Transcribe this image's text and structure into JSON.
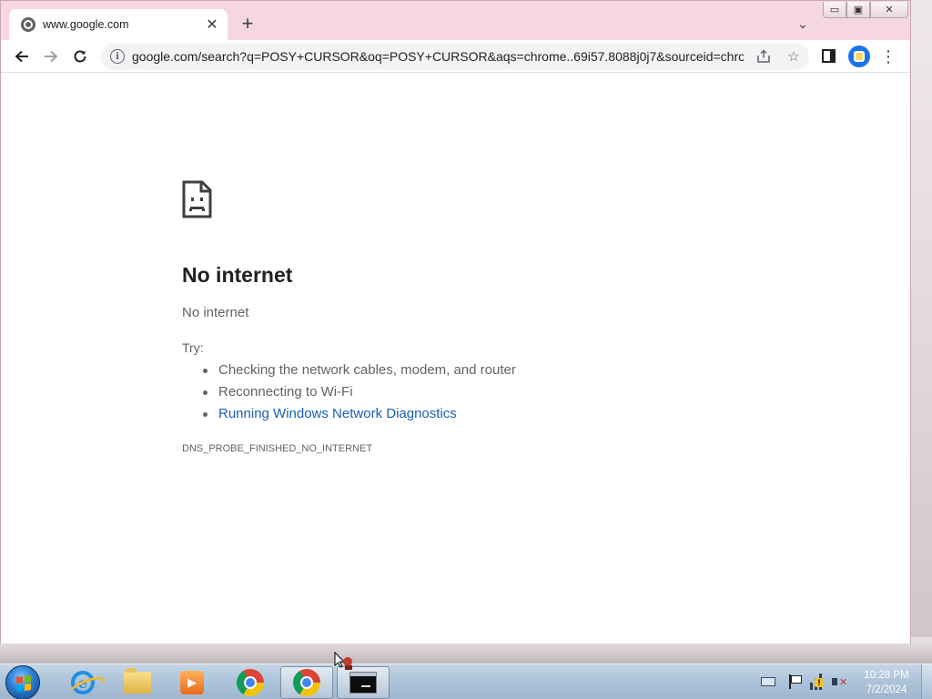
{
  "browser": {
    "tab": {
      "title": "www.google.com",
      "favicon": "globe-icon"
    },
    "new_tab_label": "+",
    "tab_search_glyph": "⌄",
    "window_controls": {
      "minimize": "▭",
      "maximize": "▣",
      "close": "✕"
    },
    "omnibox": {
      "url": "google.com/search?q=POSY+CURSOR&oq=POSY+CURSOR&aqs=chrome..69i57.8088j0j7&sourceid=chro..."
    }
  },
  "error_page": {
    "title": "No internet",
    "subtitle": "No internet",
    "try_label": "Try:",
    "suggestions": [
      {
        "text": "Checking the network cables, modem, and router",
        "link": false
      },
      {
        "text": "Reconnecting to Wi-Fi",
        "link": false
      },
      {
        "text": "Running Windows Network Diagnostics",
        "link": true
      }
    ],
    "error_code": "DNS_PROBE_FINISHED_NO_INTERNET"
  },
  "taskbar": {
    "pinned": [
      "internet-explorer-icon",
      "file-explorer-icon",
      "media-player-icon",
      "chrome-icon",
      "chrome-icon-active",
      "command-prompt-icon"
    ],
    "clock_time": "10:28 PM",
    "clock_date": "7/2/2024"
  },
  "colors": {
    "titlebar": "#f6d7e0",
    "link": "#1a5fb4",
    "text_secondary": "#5f6368"
  }
}
